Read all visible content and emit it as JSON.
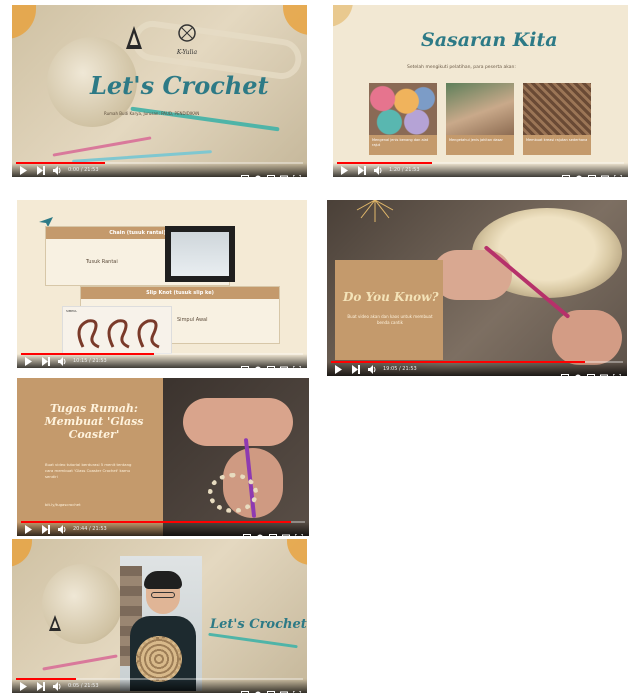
{
  "frames": [
    {
      "title": "Let's Crochet",
      "subtitle": "Rumah Budi Karya, Jurusan: PAUD, PENDIDIKAN",
      "brand": "K-Yulia",
      "time": "0:00 / 21:53",
      "progress": 0.31
    },
    {
      "title": "Sasaran Kita",
      "subtitle": "Setelah mengikuti pelatihan, para peserta akan:",
      "cards": [
        "Mengenal jenis benang dan alat rajut",
        "Mengetahui jenis jahitan dasar",
        "Membuat kreasi rajutan sederhana"
      ],
      "time": "1:20 / 21:53",
      "progress": 0.33
    },
    {
      "row1_title": "Chain (tusuk rantai)",
      "row1_label": "Tusuk Rantai",
      "row2_title": "Slip Knot (tusuk slip ke)",
      "row2_label": "Simpul Awal",
      "tag": "SIMPUL",
      "time": "10:15 / 21:53",
      "progress": 0.47
    },
    {
      "title": "Do You Know?",
      "body": "Buat video akan dan kaos untuk membuat benda cantik",
      "time": "19:05 / 21:53",
      "progress": 0.87
    },
    {
      "title": "Tugas Rumah: Membuat 'Glass Coaster'",
      "body": "Buat video tutorial berdurasi 5 menit tentang cara membuat 'Glass Coaster Crochet' kamu sendiri",
      "link": "bit.ly/tugascrochet",
      "time": "20:44 / 21:53",
      "progress": 0.95
    },
    {
      "title": "Let's Crochet",
      "time": "0:05 / 21:53",
      "progress": 0.21
    }
  ],
  "colors": {
    "teal": "#2d7a86",
    "tan": "#c49a6c",
    "cream": "#f4ead5",
    "progress_red": "#ff0000"
  },
  "icons": {
    "play": "play-icon",
    "next": "next-icon",
    "volume": "volume-icon",
    "subtitles": "subtitles-icon",
    "settings": "gear-icon",
    "miniplayer": "miniplayer-icon",
    "theater": "theater-icon",
    "fullscreen": "fullscreen-icon"
  }
}
